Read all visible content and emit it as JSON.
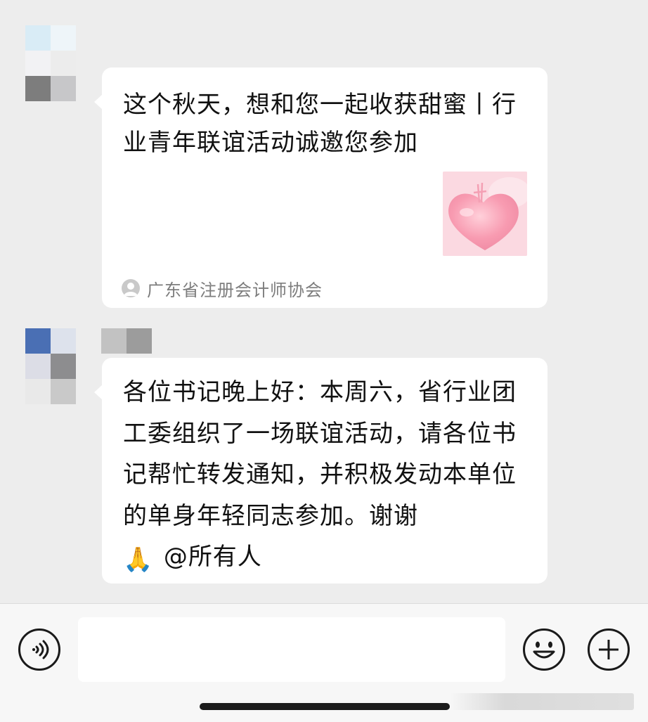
{
  "messages": [
    {
      "type": "link_card",
      "title": "这个秋天，想和您一起收获甜蜜丨行业青年联谊活动诚邀您参加",
      "thumbnail": "heart-thumbnail",
      "source": "广东省注册会计师协会"
    },
    {
      "type": "text",
      "text": "各位书记晚上好：本周六，省行业团工委组织了一场联谊活动，请各位书记帮忙转发通知，并积极发动本单位的单身年轻同志参加。谢谢",
      "emoji": "🙏",
      "mention": "@所有人"
    }
  ],
  "input_bar": {
    "voice_icon": "voice-icon",
    "input_value": "",
    "emoji_icon": "smiley-icon",
    "plus_icon": "plus-icon"
  },
  "colors": {
    "background": "#ededed",
    "bubble": "#ffffff",
    "input_bar": "#f7f7f7",
    "secondary_text": "#7d7d7d"
  }
}
